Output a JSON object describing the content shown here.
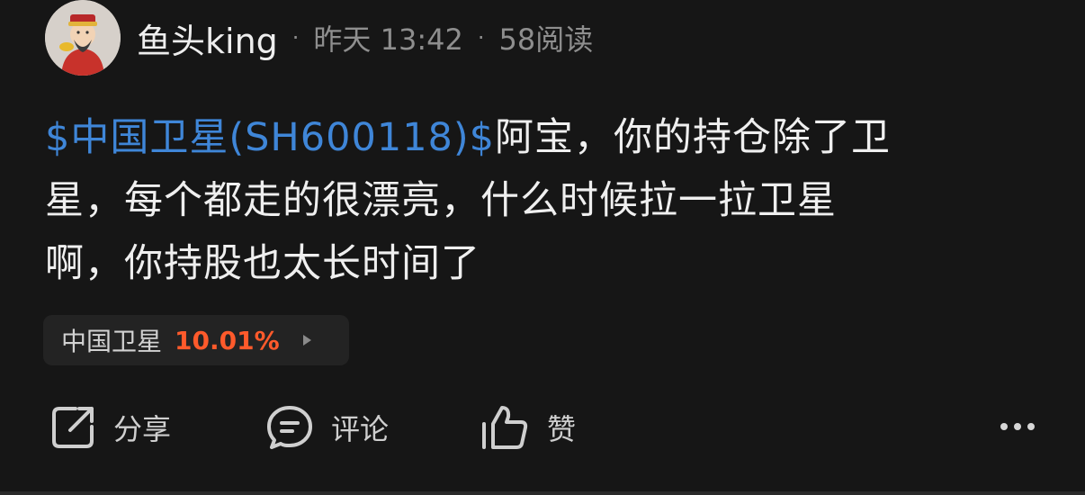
{
  "post": {
    "author": {
      "name": "鱼头king",
      "avatar_icon": "fortune-god-avatar"
    },
    "time": "昨天 13:42",
    "reads": "58阅读",
    "content": {
      "stock_link": "$中国卫星(SH600118)$",
      "body_lines": [
        "阿宝，你的持仓除了卫",
        "星，每个都走的很漂亮，什么时候拉一拉卫星",
        "啊，你持股也太长时间了"
      ]
    },
    "stock_chip": {
      "name": "中国卫星",
      "change": "10.01%",
      "change_color": "#ff5a2b"
    }
  },
  "actions": {
    "share": {
      "label": "分享",
      "icon": "share-icon"
    },
    "comment": {
      "label": "评论",
      "icon": "comment-icon"
    },
    "like": {
      "label": "赞",
      "icon": "thumbs-up-icon"
    },
    "more": {
      "icon": "more-icon"
    }
  },
  "colors": {
    "background": "#161616",
    "link": "#3f86d8",
    "muted": "#8e8e8e"
  }
}
